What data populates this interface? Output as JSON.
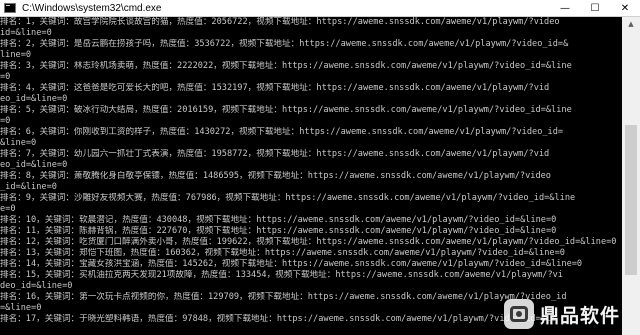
{
  "window": {
    "title": "C:\\Windows\\system32\\cmd.exe",
    "minimize_glyph": "—",
    "maximize_glyph": "☐",
    "close_glyph": "✕"
  },
  "console": {
    "lines": [
      "排名：1，关键词：故宫学院院长谈故宫的猫，热度值：2056722，视频下载地址：https://aweme.snssdk.com/aweme/v1/playwm/?video",
      "id=&line=0",
      "排名：2，关键词：是岳云鹏在捞孩子吗，热度值：3536722，视频下载地址：https://aweme.snssdk.com/aweme/v1/playwm/?video_id=&",
      "line=0",
      "排名：3，关键词：林志玲机场卖萌，热度值：2222022，视频下载地址：https://aweme.snssdk.com/aweme/v1/playwm/?video_id=&line",
      "=0",
      "排名：4，关键词：这爸爸是吃可爱长大的吧，热度值：1532197，视频下载地址：https://aweme.snssdk.com/aweme/v1/playwm/?vid",
      "eo_id=&line=0",
      "排名：5，关键词：破冰行动大结局，热度值：2016159，视频下载地址：https://aweme.snssdk.com/aweme/v1/playwm/?video_id=&line",
      "=0",
      "排名：6，关键词：你刚收到工资的样子，热度值：1430272，视频下载地址：https://aweme.snssdk.com/aweme/v1/playwm/?video_id=",
      "&line=0",
      "排名：7，关键词：幼儿园六一抓壮丁式表演，热度值：1958772，视频下载地址：https://aweme.snssdk.com/aweme/v1/playwm/?vid",
      "eo_id=&line=0",
      "排名：8，关键词：萧敬腾化身白敬亭保镖，热度值：1486595，视频下载地址：https://aweme.snssdk.com/aweme/v1/playwm/?video",
      "_id=&line=0",
      "排名：9，关键词：沙雕好友视频大赛，热度值：767986，视频下载地址：https://aweme.snssdk.com/aweme/v1/playwm/?video_id=&line",
      "e=0",
      "排名：10，关键词：软晨潜记，热度值：430048，视频下载地址：https://aweme.snssdk.com/aweme/v1/playwm/?video_id=&line=0",
      "排名：11，关键词：陈赫背锅，热度值：227670，视频下载地址：https://aweme.snssdk.com/aweme/v1/playwm/?video_id=&line=0",
      "排名：12，关键词：吃货厦门口醉满外卖小哥，热度值：199622，视频下载地址：https://aweme.snssdk.com/aweme/v1/playwm/?video_id=&line=0",
      "排名：13，关键词：郑恺下班图，热度值：160362，视频下载地址：https://aweme.snssdk.com/aweme/v1/playwm/?video_id=&line=0",
      "排名：14，关键词：宝藏女孩洪宝涵，热度值：145262，视频下载地址：https://aweme.snssdk.com/aweme/v1/playwm/?video_id=&line=0",
      "排名：15，关键词：买机油拉克两天发现21项故障，热度值：133454，视频下载地址：https://aweme.snssdk.com/aweme/v1/playwm/?vi",
      "deo_id=&line=0",
      "排名：16，关键词：第一次玩卡点视频的你，热度值：129709，视频下载地址：https://aweme.snssdk.com/aweme/v1/playwm/?video_id",
      "=&line=0",
      "排名：17，关键词：于晓光塑料韩语，热度值：97848，视频下载地址：https://aweme.snssdk.com/aweme/v1/playwm/?video_id=&li"
    ]
  },
  "scrollbar": {
    "up_glyph": "▲"
  },
  "watermark": {
    "text": "鼎品软件",
    "icon": "tiktok-logo-icon"
  }
}
